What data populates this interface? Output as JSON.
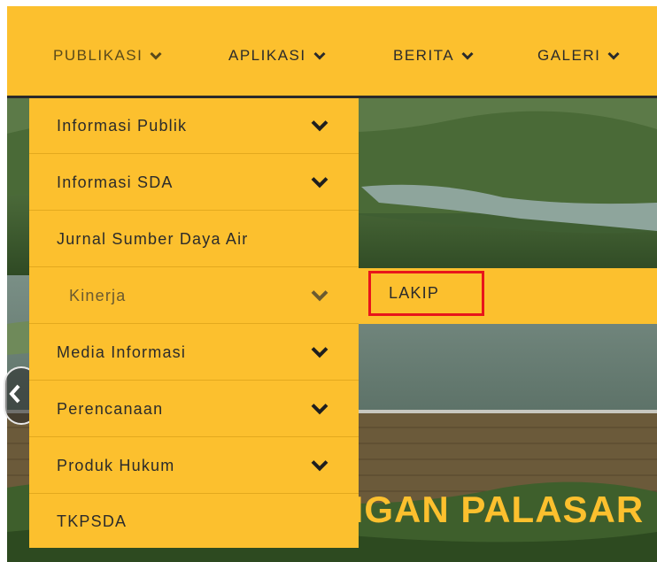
{
  "nav": {
    "items": [
      {
        "label": "PUBLIKASI",
        "active": true
      },
      {
        "label": "APLIKASI",
        "active": false
      },
      {
        "label": "BERITA",
        "active": false
      },
      {
        "label": "GALERI",
        "active": false
      }
    ]
  },
  "dropdown": {
    "items": [
      {
        "label": "Informasi Publik",
        "has_submenu": true
      },
      {
        "label": "Informasi SDA",
        "has_submenu": true
      },
      {
        "label": "Jurnal Sumber Daya Air",
        "has_submenu": false
      },
      {
        "label": "Kinerja",
        "has_submenu": true,
        "active": true
      },
      {
        "label": "Media Informasi",
        "has_submenu": true
      },
      {
        "label": "Perencanaan",
        "has_submenu": true
      },
      {
        "label": "Produk Hukum",
        "has_submenu": true
      },
      {
        "label": "TKPSDA",
        "has_submenu": false
      }
    ]
  },
  "submenu": {
    "items": [
      {
        "label": "LAKIP",
        "highlighted": true
      }
    ]
  },
  "hero": {
    "title": "NGAN PALASAR"
  },
  "carousel": {
    "prev_icon": "chevron-left-icon"
  },
  "colors": {
    "brand_yellow": "#fcc02e",
    "highlight_red": "#e8151b",
    "text_dark": "#2b2b2b",
    "separator": "#e3a91e"
  }
}
